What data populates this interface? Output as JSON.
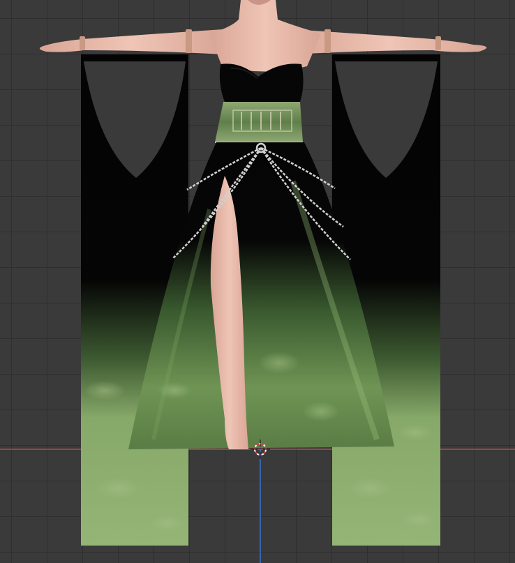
{
  "viewport": {
    "background": "#3a3a3a",
    "grid_line_color": "#2f2f2f",
    "x_axis_color": "#d04040",
    "y_axis_color": "#3d6fd0",
    "cursor_colors": [
      "#d04040",
      "#ffffff"
    ]
  },
  "model": {
    "pose": "t-pose",
    "dress_colors": {
      "black": "#050505",
      "green_dark": "#2f4a28",
      "green_light": "#8fb06d",
      "belt": "#6f8f5a",
      "chain": "#c8c8c8",
      "skin": "#e7b8a8",
      "arm_band": "#c89a84"
    }
  },
  "icons": [
    "3d-cursor-icon"
  ]
}
